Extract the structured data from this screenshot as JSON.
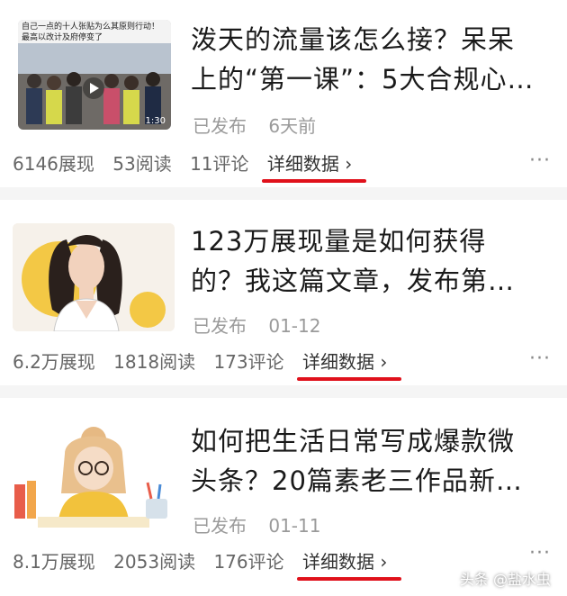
{
  "feed": {
    "articles": [
      {
        "title_line1": "泼天的流量该怎么接？呆呆",
        "title_line2": "上的“第一课”：5大合规心…",
        "status": "已发布",
        "time": "6天前",
        "impressions": "6146展现",
        "reads": "53阅读",
        "comments": "11评论",
        "detail_label": "详细数据 ›",
        "more_label": "···",
        "thumb_caption_line1": "自己一点的十人张贴为么其原则行动！",
        "thumb_caption_line2": "最高以改计及府停变了",
        "thumb_timestamp": "1:30"
      },
      {
        "title_line1": "123万展现量是如何获得",
        "title_line2": "的？我这篇文章，发布第…",
        "status": "已发布",
        "time": "01-12",
        "impressions": "6.2万展现",
        "reads": "1818阅读",
        "comments": "173评论",
        "detail_label": "详细数据 ›",
        "more_label": "···"
      },
      {
        "title_line1": "如何把生活日常写成爆款微",
        "title_line2": "头条？20篇素老三作品新…",
        "status": "已发布",
        "time": "01-11",
        "impressions": "8.1万展现",
        "reads": "2053阅读",
        "comments": "176评论",
        "detail_label": "详细数据 ›",
        "more_label": "···"
      }
    ]
  },
  "watermark": "头条 @盐水虫",
  "colors": {
    "accent_underline": "#e0111b",
    "title": "#1a1a1a",
    "meta": "#9a9a9a"
  }
}
